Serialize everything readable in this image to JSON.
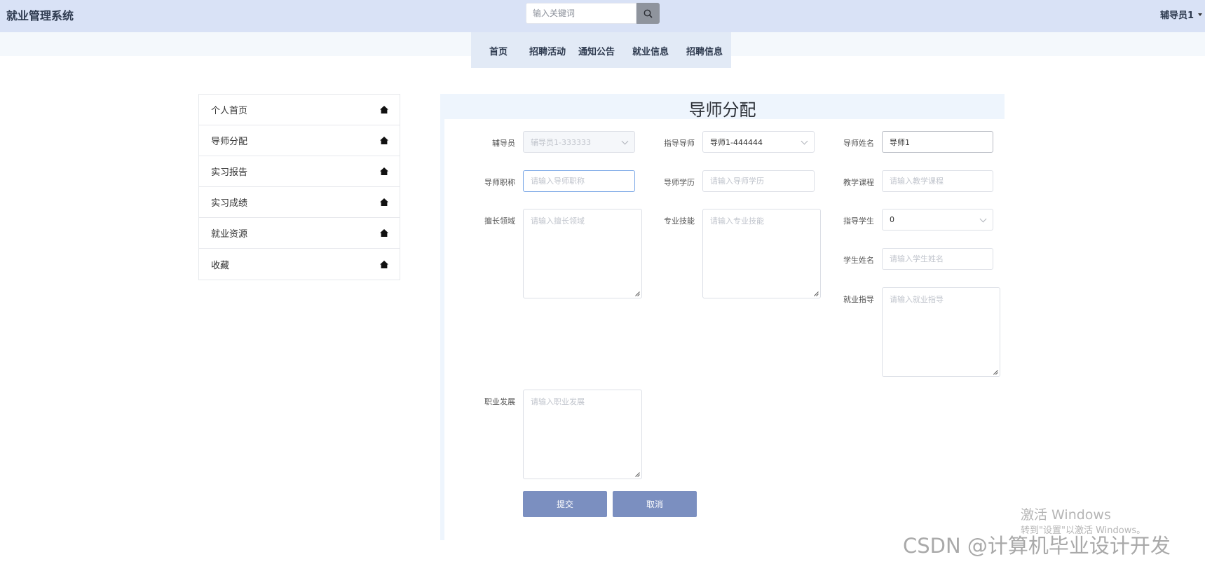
{
  "header": {
    "brand": "就业管理系统",
    "search": {
      "placeholder": "输入关键词"
    },
    "user_label": "辅导员1"
  },
  "nav": {
    "items": [
      "首页",
      "招聘活动",
      "通知公告",
      "就业信息",
      "招聘信息"
    ]
  },
  "sidebar": {
    "items": [
      "个人首页",
      "导师分配",
      "实习报告",
      "实习成绩",
      "就业资源",
      "收藏"
    ]
  },
  "form": {
    "title": "导师分配",
    "counselor": {
      "label": "辅导员",
      "value": "辅导员1-333333"
    },
    "advisor": {
      "label": "指导导师",
      "value": "导师1-444444"
    },
    "advisor_name": {
      "label": "导师姓名",
      "value": "导师1"
    },
    "advisor_title": {
      "label": "导师职称",
      "placeholder": "请输入导师职称"
    },
    "advisor_degree": {
      "label": "导师学历",
      "placeholder": "请输入导师学历"
    },
    "course": {
      "label": "教学课程",
      "placeholder": "请输入教学课程"
    },
    "expertise": {
      "label": "擅长领域",
      "placeholder": "请输入擅长领域"
    },
    "skills": {
      "label": "专业技能",
      "placeholder": "请输入专业技能"
    },
    "student": {
      "label": "指导学生",
      "value": "0"
    },
    "student_name": {
      "label": "学生姓名",
      "placeholder": "请输入学生姓名"
    },
    "career_guidance": {
      "label": "就业指导",
      "placeholder": "请输入就业指导"
    },
    "career_dev": {
      "label": "职业发展",
      "placeholder": "请输入职业发展"
    },
    "submit": "提交",
    "cancel": "取消"
  },
  "overlay": {
    "activate_title": "激活 Windows",
    "activate_sub": "转到\"设置\"以激活 Windows。",
    "csdn": "CSDN @计算机毕业设计开发"
  }
}
